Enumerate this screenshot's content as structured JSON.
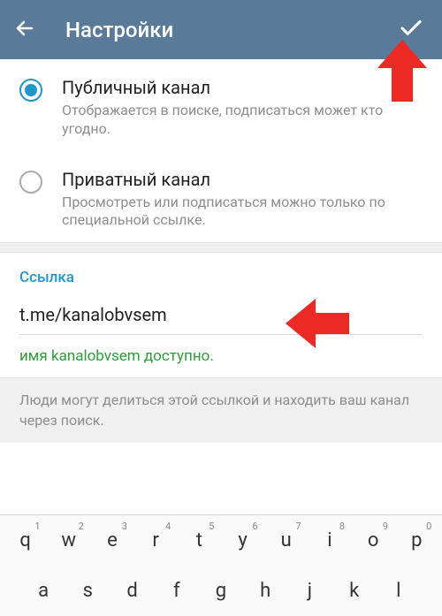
{
  "header": {
    "title": "Настройки"
  },
  "options": {
    "public": {
      "title": "Публичный канал",
      "desc": "Отображается в поиске, подписаться может кто угодно."
    },
    "private": {
      "title": "Приватный канал",
      "desc": "Просмотреть или подписаться можно только по специальной ссылке."
    }
  },
  "link": {
    "label": "Ссылка",
    "value": "t.me/kanalobvsem",
    "availability": "имя kanalobvsem доступно."
  },
  "hint": "Люди могут делиться этой ссылкой и находить ваш канал через поиск.",
  "keyboard": {
    "row1": [
      {
        "k": "q",
        "n": "1"
      },
      {
        "k": "w",
        "n": "2"
      },
      {
        "k": "e",
        "n": "3"
      },
      {
        "k": "r",
        "n": "4"
      },
      {
        "k": "t",
        "n": "5"
      },
      {
        "k": "y",
        "n": "6"
      },
      {
        "k": "u",
        "n": "7"
      },
      {
        "k": "i",
        "n": "8"
      },
      {
        "k": "o",
        "n": "9"
      },
      {
        "k": "p",
        "n": "0"
      }
    ],
    "row2": [
      {
        "k": "a"
      },
      {
        "k": "s"
      },
      {
        "k": "d"
      },
      {
        "k": "f"
      },
      {
        "k": "g"
      },
      {
        "k": "h"
      },
      {
        "k": "j"
      },
      {
        "k": "k"
      },
      {
        "k": "l"
      }
    ]
  },
  "colors": {
    "headerBg": "#5a7a99",
    "accent": "#2196c9",
    "success": "#2e9c3a",
    "arrow": "#eb2a26"
  }
}
